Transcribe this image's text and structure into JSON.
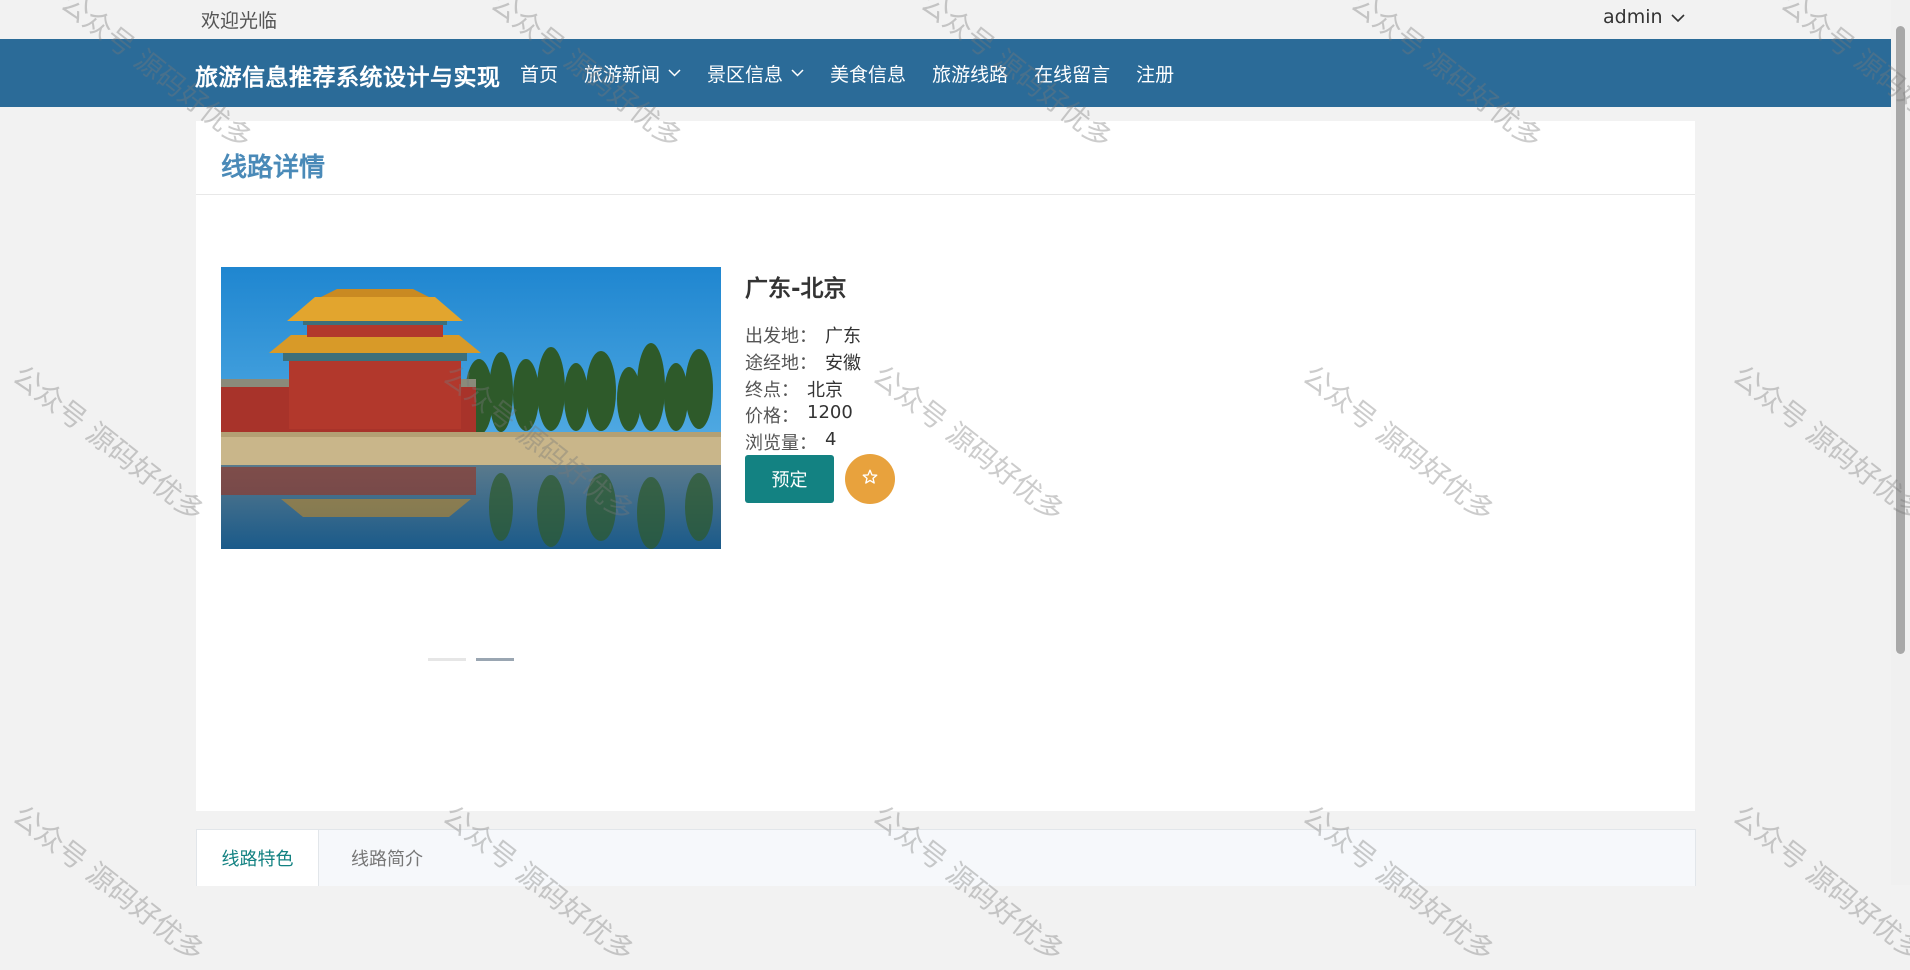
{
  "topbar": {
    "welcome": "欢迎光临",
    "user": "admin"
  },
  "navbar": {
    "brand": "旅游信息推荐系统设计与实现",
    "items": [
      {
        "label": "首页",
        "has_dropdown": false
      },
      {
        "label": "旅游新闻",
        "has_dropdown": true
      },
      {
        "label": "景区信息",
        "has_dropdown": true
      },
      {
        "label": "美食信息",
        "has_dropdown": false
      },
      {
        "label": "旅游线路",
        "has_dropdown": false
      },
      {
        "label": "在线留言",
        "has_dropdown": false
      },
      {
        "label": "注册",
        "has_dropdown": false
      }
    ]
  },
  "detail": {
    "section_title": "线路详情",
    "route_name": "广东-北京",
    "fields": [
      {
        "label": "出发地：",
        "value": "广东"
      },
      {
        "label": "途经地：",
        "value": "安徽"
      },
      {
        "label": "终点：",
        "value": "北京"
      },
      {
        "label": "价格：",
        "value": "1200"
      },
      {
        "label": "浏览量：",
        "value": "4"
      }
    ],
    "book_label": "预定",
    "favorite_icon": "star-icon",
    "carousel": {
      "slides": 2,
      "active_index": 1
    }
  },
  "tabs": [
    {
      "label": "线路特色",
      "active": true
    },
    {
      "label": "线路简介",
      "active": false
    }
  ],
  "watermark": "公众号 源码好优多",
  "colors": {
    "nav_bg": "#2b6b98",
    "section_title": "#4a8ab8",
    "primary_button": "#138282",
    "favorite_button": "#e8a23d",
    "active_tab_text": "#138282"
  }
}
